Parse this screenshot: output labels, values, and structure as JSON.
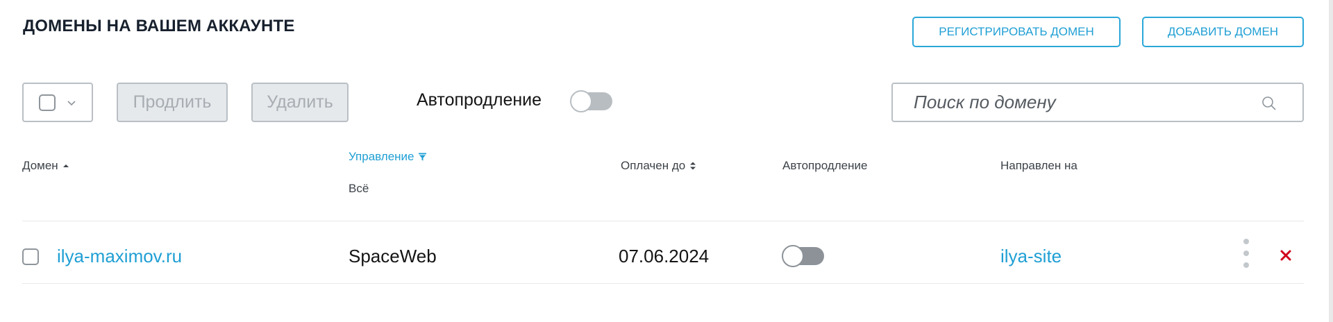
{
  "header": {
    "title": "ДОМЕНЫ НА ВАШЕМ АККАУНТЕ",
    "register_label": "РЕГИСТРИРОВАТЬ ДОМЕН",
    "add_label": "ДОБАВИТЬ ДОМЕН"
  },
  "toolbar": {
    "renew_label": "Продлить",
    "delete_label": "Удалить",
    "autorenew_label": "Автопродление",
    "autorenew_on": false
  },
  "search": {
    "placeholder": "Поиск по домену",
    "value": ""
  },
  "table": {
    "columns": {
      "domain": "Домен",
      "management": "Управление",
      "management_filter": "Всё",
      "paid_until": "Оплачен до",
      "autorenew": "Автопродление",
      "pointed_to": "Направлен на"
    },
    "rows": [
      {
        "domain": "ilya-maximov.ru",
        "management": "SpaceWeb",
        "paid_until": "07.06.2024",
        "autorenew": false,
        "pointed_to": "ilya-site"
      }
    ]
  },
  "icons": {
    "select_chevron": "chevron-down-icon",
    "sort_asc": "sort-asc-icon",
    "filter": "filter-icon",
    "sort_both": "sort-icon",
    "search": "search-icon",
    "more": "kebab-menu-icon",
    "remove": "close-icon"
  },
  "colors": {
    "accent": "#1f9fd4",
    "danger": "#d0021b",
    "title": "#17202d",
    "toggle_off": "#8c9298"
  }
}
